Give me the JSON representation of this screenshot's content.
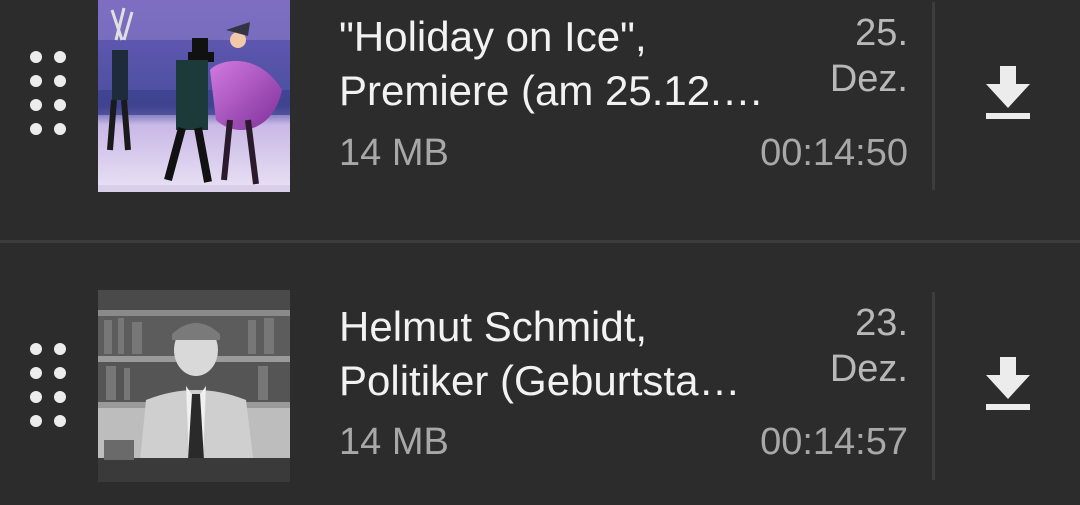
{
  "items": [
    {
      "title_line1": "\"Holiday on Ice\",",
      "title_line2": "Premiere (am 25.12.…",
      "date_day": "25.",
      "date_month": "Dez.",
      "size": "14 MB",
      "duration": "00:14:50",
      "thumbnail_icon": "ice-show-photo",
      "action_icon": "download-icon"
    },
    {
      "title_line1": "Helmut Schmidt,",
      "title_line2": "Politiker (Geburtsta…",
      "date_day": "23.",
      "date_month": "Dez.",
      "size": "14 MB",
      "duration": "00:14:57",
      "thumbnail_icon": "portrait-photo",
      "action_icon": "download-icon"
    }
  ],
  "colors": {
    "background": "#2c2c2c",
    "divider": "#3d3d3d",
    "title_text": "#f2f2f2",
    "secondary_text": "#a8a8a8",
    "icon": "#ececec"
  }
}
